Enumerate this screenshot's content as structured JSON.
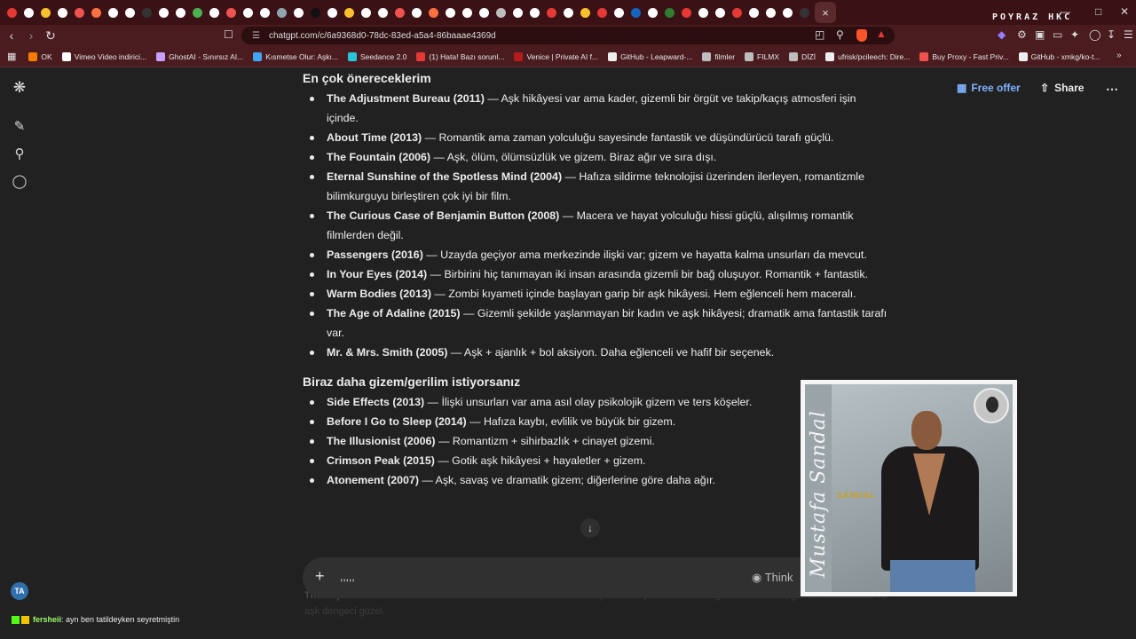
{
  "browser": {
    "tab_favicon_colors": [
      "#e53935",
      "#ffffff",
      "#fbc02d",
      "#ffffff",
      "#ef5350",
      "#ff7043",
      "#ffffff",
      "#ffffff",
      "#333333",
      "#ffffff",
      "#ffffff",
      "#4caf50",
      "#ffffff",
      "#ef5350",
      "#ffffff",
      "#ffffff",
      "#90a4ae",
      "#ffffff",
      "#111111",
      "#ffffff",
      "#fbc02d",
      "#ffffff",
      "#ffffff",
      "#ef5350",
      "#ffffff",
      "#ff7043",
      "#ffffff",
      "#ffffff",
      "#ffffff",
      "#bdbdbd",
      "#ffffff",
      "#ffffff",
      "#e53935",
      "#ffffff",
      "#fbc02d",
      "#e53935",
      "#ffffff",
      "#1565c0",
      "#ffffff",
      "#2e7d32",
      "#e53935",
      "#ffffff",
      "#ffffff",
      "#e53935",
      "#ffffff",
      "#ffffff",
      "#ffffff",
      "#333333"
    ],
    "active_tab_close": "×",
    "brand_text": "POYRAZ HKC",
    "window_controls": [
      "—",
      "□",
      "✕"
    ],
    "url": "chatgpt.com/c/6a9368d0-78dc-83ed-a5a4-86baaae4369d",
    "bookmarks": [
      {
        "label": "OK",
        "color": "#f57c00"
      },
      {
        "label": "Vimeo Video indirici...",
        "color": "#ffffff"
      },
      {
        "label": "GhostAI - Sınırsız AI...",
        "color": "#c8a0ff"
      },
      {
        "label": "Kısmetse Olur: Aşkı...",
        "color": "#42a5f5"
      },
      {
        "label": "Seedance 2.0",
        "color": "#26c6da"
      },
      {
        "label": "(1) Hata! Bazı sorunl...",
        "color": "#e53935"
      },
      {
        "label": "Venice | Private AI f...",
        "color": "#b71c1c"
      },
      {
        "label": "GitHub - Leapward-...",
        "color": "#eeeeee"
      },
      {
        "label": "filmler",
        "color": "#bdbdbd"
      },
      {
        "label": "FILMX",
        "color": "#bdbdbd"
      },
      {
        "label": "DİZİ",
        "color": "#bdbdbd"
      },
      {
        "label": "ufrisk/pcileech: Dire...",
        "color": "#eeeeee"
      },
      {
        "label": "Buy Proxy - Fast Priv...",
        "color": "#ef5350"
      },
      {
        "label": "GitHub - xmkg/ko-t...",
        "color": "#eeeeee"
      }
    ]
  },
  "header": {
    "free_offer": "Free offer",
    "share": "Share",
    "more": "⋯"
  },
  "sidebar": {
    "avatar_initials": "TA"
  },
  "section1": {
    "heading": "En çok önereceklerim",
    "items": [
      {
        "title": "The Adjustment Bureau (2011)",
        "desc": " — Aşk hikâyesi var ama kader, gizemli bir örgüt ve takip/kaçış atmosferi işin içinde."
      },
      {
        "title": "About Time (2013)",
        "desc": " — Romantik ama zaman yolculuğu sayesinde fantastik ve düşündürücü tarafı güçlü."
      },
      {
        "title": "The Fountain (2006)",
        "desc": " — Aşk, ölüm, ölümsüzlük ve gizem. Biraz ağır ve sıra dışı."
      },
      {
        "title": "Eternal Sunshine of the Spotless Mind (2004)",
        "desc": " — Hafıza sildirme teknolojisi üzerinden ilerleyen, romantizmle bilimkurguyu birleştiren çok iyi bir film."
      },
      {
        "title": "The Curious Case of Benjamin Button (2008)",
        "desc": " — Macera ve hayat yolculuğu hissi güçlü, alışılmış romantik filmlerden değil."
      },
      {
        "title": "Passengers (2016)",
        "desc": " — Uzayda geçiyor ama merkezinde ilişki var; gizem ve hayatta kalma unsurları da mevcut."
      },
      {
        "title": "In Your Eyes (2014)",
        "desc": " — Birbirini hiç tanımayan iki insan arasında gizemli bir bağ oluşuyor. Romantik + fantastik."
      },
      {
        "title": "Warm Bodies (2013)",
        "desc": " — Zombi kıyameti içinde başlayan garip bir aşk hikâyesi. Hem eğlenceli hem maceralı."
      },
      {
        "title": "The Age of Adaline (2015)",
        "desc": " — Gizemli şekilde yaşlanmayan bir kadın ve aşk hikâyesi; dramatik ama fantastik tarafı var."
      },
      {
        "title": "Mr. & Mrs. Smith (2005)",
        "desc": " — Aşk + ajanlık + bol aksiyon. Daha eğlenceli ve hafif bir seçenek."
      }
    ]
  },
  "section2": {
    "heading": "Biraz daha gizem/gerilim istiyorsanız",
    "items": [
      {
        "title": "Side Effects (2013)",
        "desc": " — İlişki unsurları var ama asıl olay psikolojik gizem ve ters köşeler."
      },
      {
        "title": "Before I Go to Sleep (2014)",
        "desc": " — Hafıza kaybı, evlilik ve büyük bir gizem."
      },
      {
        "title": "The Illusionist (2006)",
        "desc": " — Romantizm + sihirbazlık + cinayet gizemi."
      },
      {
        "title": "Crimson Peak (2015)",
        "desc": " — Gotik aşk hikâyesi + hayaletler + gizem."
      },
      {
        "title": "Atonement (2007)",
        "desc": " — Aşk, savaş ve dramatik gizem; diğerlerine göre daha ağır."
      }
    ]
  },
  "faded_text": {
    "title": "The Adjustment Bureau",
    "desc": " derim. Tam olarak \"romantik ama filmin başka bir olayı da olsun\" kategorisinde. Kader, gizem, kovalamaca ve aşk dengeci güzel."
  },
  "composer": {
    "input_value": ",,,,,",
    "think_label": "Think",
    "plus": "+",
    "mic": "🎙",
    "send": "↑"
  },
  "overlay": {
    "artist": "Mustafa Sandal",
    "album_title": "SANDAL"
  },
  "chat": {
    "user": "fersheii",
    "message": " : ayn ben tatildeyken seyretmiştin"
  }
}
